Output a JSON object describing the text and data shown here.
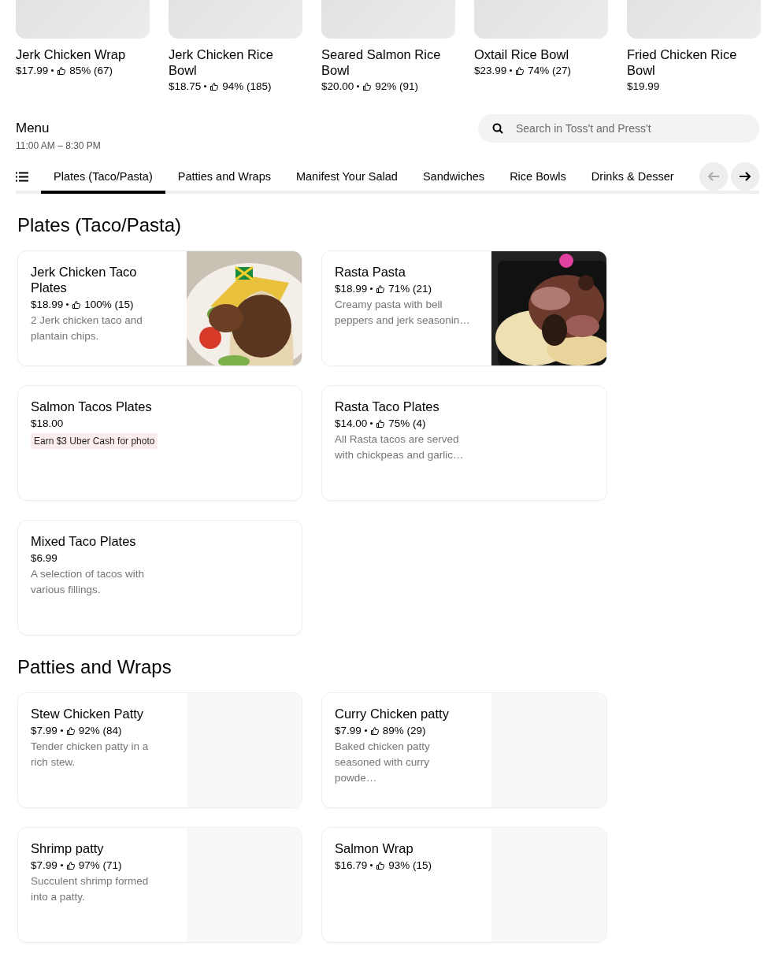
{
  "featured": [
    {
      "title": "Jerk Chicken Wrap",
      "price": "$17.99",
      "rating": "85% (67)"
    },
    {
      "title": "Jerk Chicken Rice Bowl",
      "price": "$18.75",
      "rating": "94% (185)"
    },
    {
      "title": "Seared Salmon Rice Bowl",
      "price": "$20.00",
      "rating": "92% (91)"
    },
    {
      "title": "Oxtail Rice Bowl",
      "price": "$23.99",
      "rating": "74% (27)"
    },
    {
      "title": "Fried Chicken Rice Bowl",
      "price": "$19.99"
    }
  ],
  "menu": {
    "title": "Menu",
    "hours": "11:00 AM – 8:30 PM"
  },
  "search": {
    "placeholder": "Search in Toss't and Press't"
  },
  "tabs": [
    {
      "label": "Plates (Taco/Pasta)",
      "selected": true
    },
    {
      "label": "Patties and Wraps",
      "selected": false
    },
    {
      "label": "Manifest Your Salad",
      "selected": false
    },
    {
      "label": "Sandwiches",
      "selected": false
    },
    {
      "label": "Rice Bowls",
      "selected": false
    },
    {
      "label": "Drinks & Desser",
      "selected": false
    }
  ],
  "tab_arrows": {
    "back_disabled": true,
    "forward_disabled": false
  },
  "sections": [
    {
      "title": "Plates (Taco/Pasta)",
      "items": [
        {
          "title": "Jerk Chicken Taco Plates",
          "price": "$18.99",
          "rating": "100% (15)",
          "description": "2 Jerk chicken taco and plantain chips."
        },
        {
          "title": "Rasta Pasta",
          "price": "$18.99",
          "rating": "71% (21)",
          "description": "Creamy pasta with bell peppers and jerk seasonin…"
        },
        {
          "title": "Salmon Tacos Plates",
          "price": "$18.00",
          "badge": "Earn $3 Uber Cash for photo"
        },
        {
          "title": "Rasta Taco Plates",
          "price": "$14.00",
          "rating": "75% (4)",
          "description": "All Rasta tacos are served with chickpeas and garlic…"
        },
        {
          "title": "Mixed Taco Plates",
          "price": "$6.99",
          "description": "A selection of tacos with various fillings."
        }
      ]
    },
    {
      "title": "Patties and Wraps",
      "items": [
        {
          "title": "Stew Chicken Patty",
          "price": "$7.99",
          "rating": "92% (84)",
          "description": "Tender chicken patty in a rich stew.",
          "image": {
            "kind": "placeholder"
          }
        },
        {
          "title": "Curry Chicken patty",
          "price": "$7.99",
          "rating": "89% (29)",
          "description": "Baked chicken patty seasoned with curry powde…",
          "image": {
            "kind": "placeholder"
          }
        },
        {
          "title": "Shrimp patty",
          "price": "$7.99",
          "rating": "97% (71)",
          "description": "Succulent shrimp formed into a patty.",
          "image": {
            "kind": "placeholder"
          }
        },
        {
          "title": "Salmon Wrap",
          "price": "$16.79",
          "rating": "93% (15)",
          "image": {
            "kind": "placeholder"
          }
        }
      ]
    }
  ]
}
